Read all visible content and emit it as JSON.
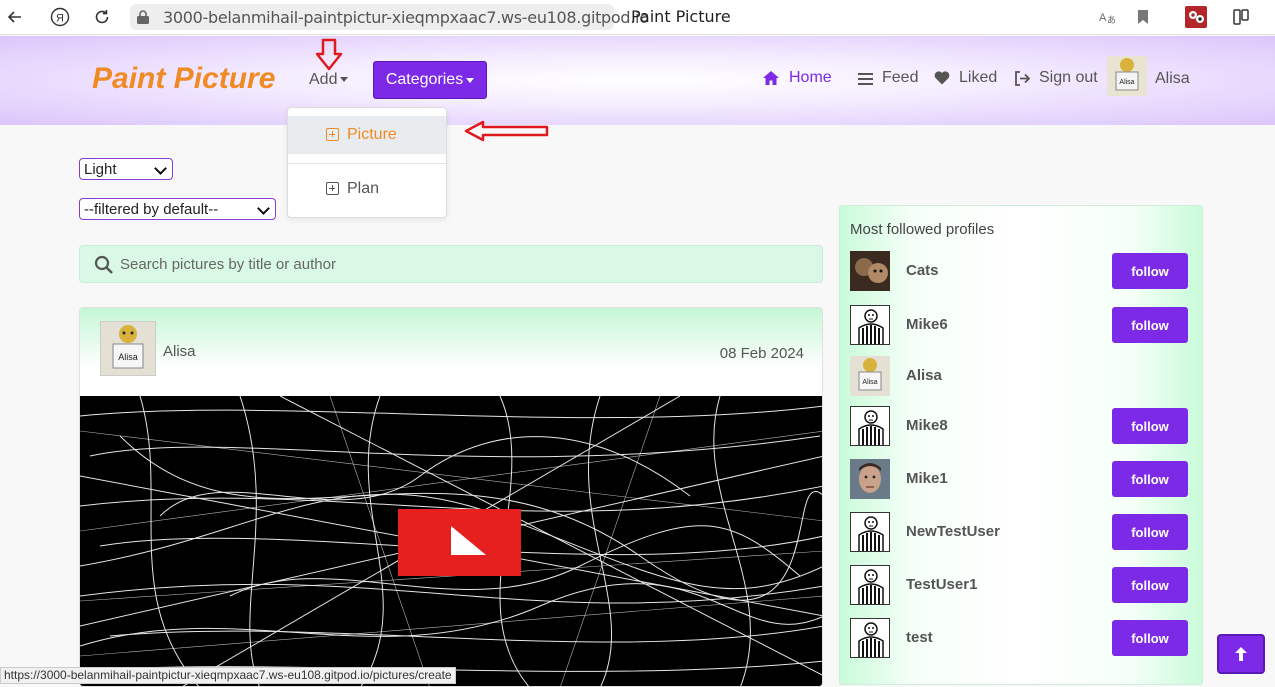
{
  "browser": {
    "url": "3000-belanmihail-paintpictur-xieqmpxaac7.ws-eu108.gitpod.io",
    "tab_title": "Paint Picture",
    "status_url": "https://3000-belanmihail-paintpictur-xieqmpxaac7.ws-eu108.gitpod.io/pictures/create"
  },
  "navbar": {
    "brand": "Paint Picture",
    "add_label": "Add",
    "categories_label": "Categories",
    "links": {
      "home": "Home",
      "feed": "Feed",
      "liked": "Liked",
      "sign_out": "Sign out"
    },
    "username": "Alisa"
  },
  "dropdown": {
    "items": [
      {
        "label": "Picture"
      },
      {
        "label": "Plan"
      }
    ]
  },
  "filters": {
    "theme": "Light",
    "filter": "--filtered by default--"
  },
  "search": {
    "placeholder": "Search pictures by title or author"
  },
  "post": {
    "author": "Alisa",
    "date": "08 Feb 2024"
  },
  "sidebar": {
    "title": "Most followed profiles",
    "follow_label": "follow",
    "profiles": [
      {
        "name": "Cats",
        "avatar": "cat-photo",
        "follow": true
      },
      {
        "name": "Mike6",
        "avatar": "default-avatar",
        "follow": true
      },
      {
        "name": "Alisa",
        "avatar": "alisa-avatar",
        "follow": false
      },
      {
        "name": "Mike8",
        "avatar": "default-avatar",
        "follow": true
      },
      {
        "name": "Mike1",
        "avatar": "face-photo",
        "follow": true
      },
      {
        "name": "NewTestUser",
        "avatar": "default-avatar",
        "follow": true
      },
      {
        "name": "TestUser1",
        "avatar": "default-avatar",
        "follow": true
      },
      {
        "name": "test",
        "avatar": "default-avatar",
        "follow": true
      }
    ]
  },
  "colors": {
    "brand_orange": "#f08a24",
    "purple": "#7d2ae8",
    "annotation_red": "#e0191f"
  }
}
